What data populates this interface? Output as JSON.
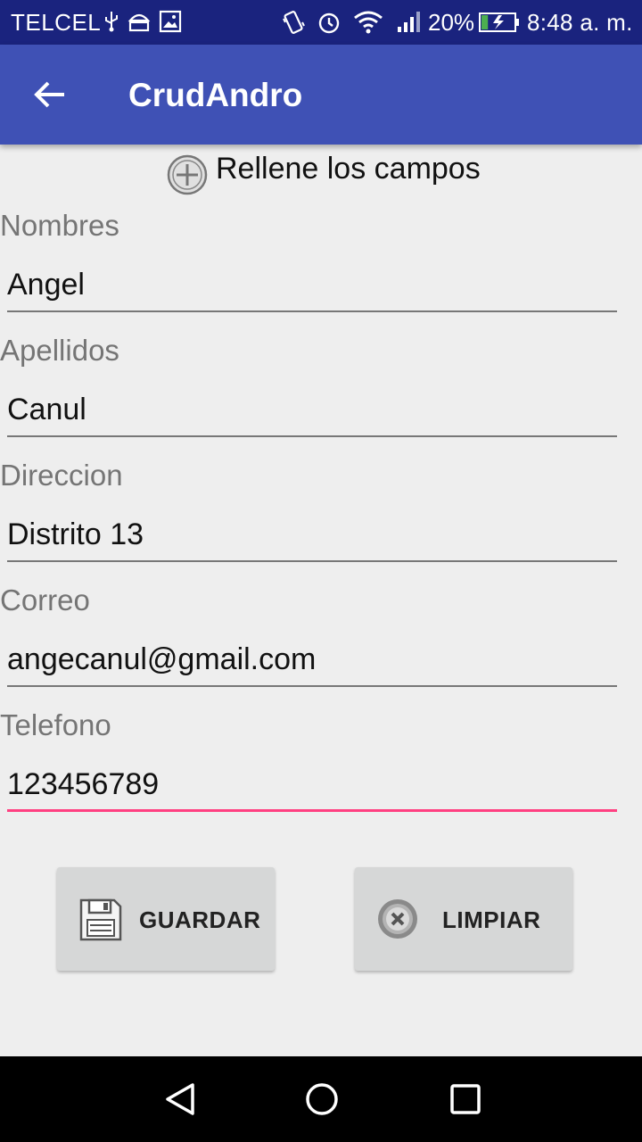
{
  "status_bar": {
    "carrier": "TELCEL",
    "battery_percent": "20%",
    "battery_level": 0.2,
    "time": "8:48 a. m.",
    "icons": [
      "usb-icon",
      "android-debug-icon",
      "image-icon",
      "vibrate-icon",
      "alarm-icon",
      "wifi-icon",
      "signal-icon",
      "battery-charging-icon"
    ]
  },
  "app_bar": {
    "title": "CrudAndro",
    "back_icon": "arrow-back-icon",
    "color": "#3f51b5"
  },
  "form": {
    "heading": "Rellene los campos",
    "heading_icon": "add-circle-icon",
    "fields": [
      {
        "label": "Nombres",
        "value": "Angel"
      },
      {
        "label": "Apellidos",
        "value": "Canul"
      },
      {
        "label": "Direccion",
        "value": "Distrito 13"
      },
      {
        "label": "Correo",
        "value": "angecanul@gmail.com"
      },
      {
        "label": "Telefono",
        "value": "123456789"
      }
    ],
    "focused_field": "Telefono",
    "accent_color": "#ff4081"
  },
  "buttons": {
    "save": {
      "label": "GUARDAR",
      "icon": "floppy-disk-icon"
    },
    "clear": {
      "label": "LIMPIAR",
      "icon": "clear-circle-icon"
    }
  },
  "nav_bar": {
    "icons": [
      "back-triangle-icon",
      "home-circle-icon",
      "recents-square-icon"
    ]
  }
}
